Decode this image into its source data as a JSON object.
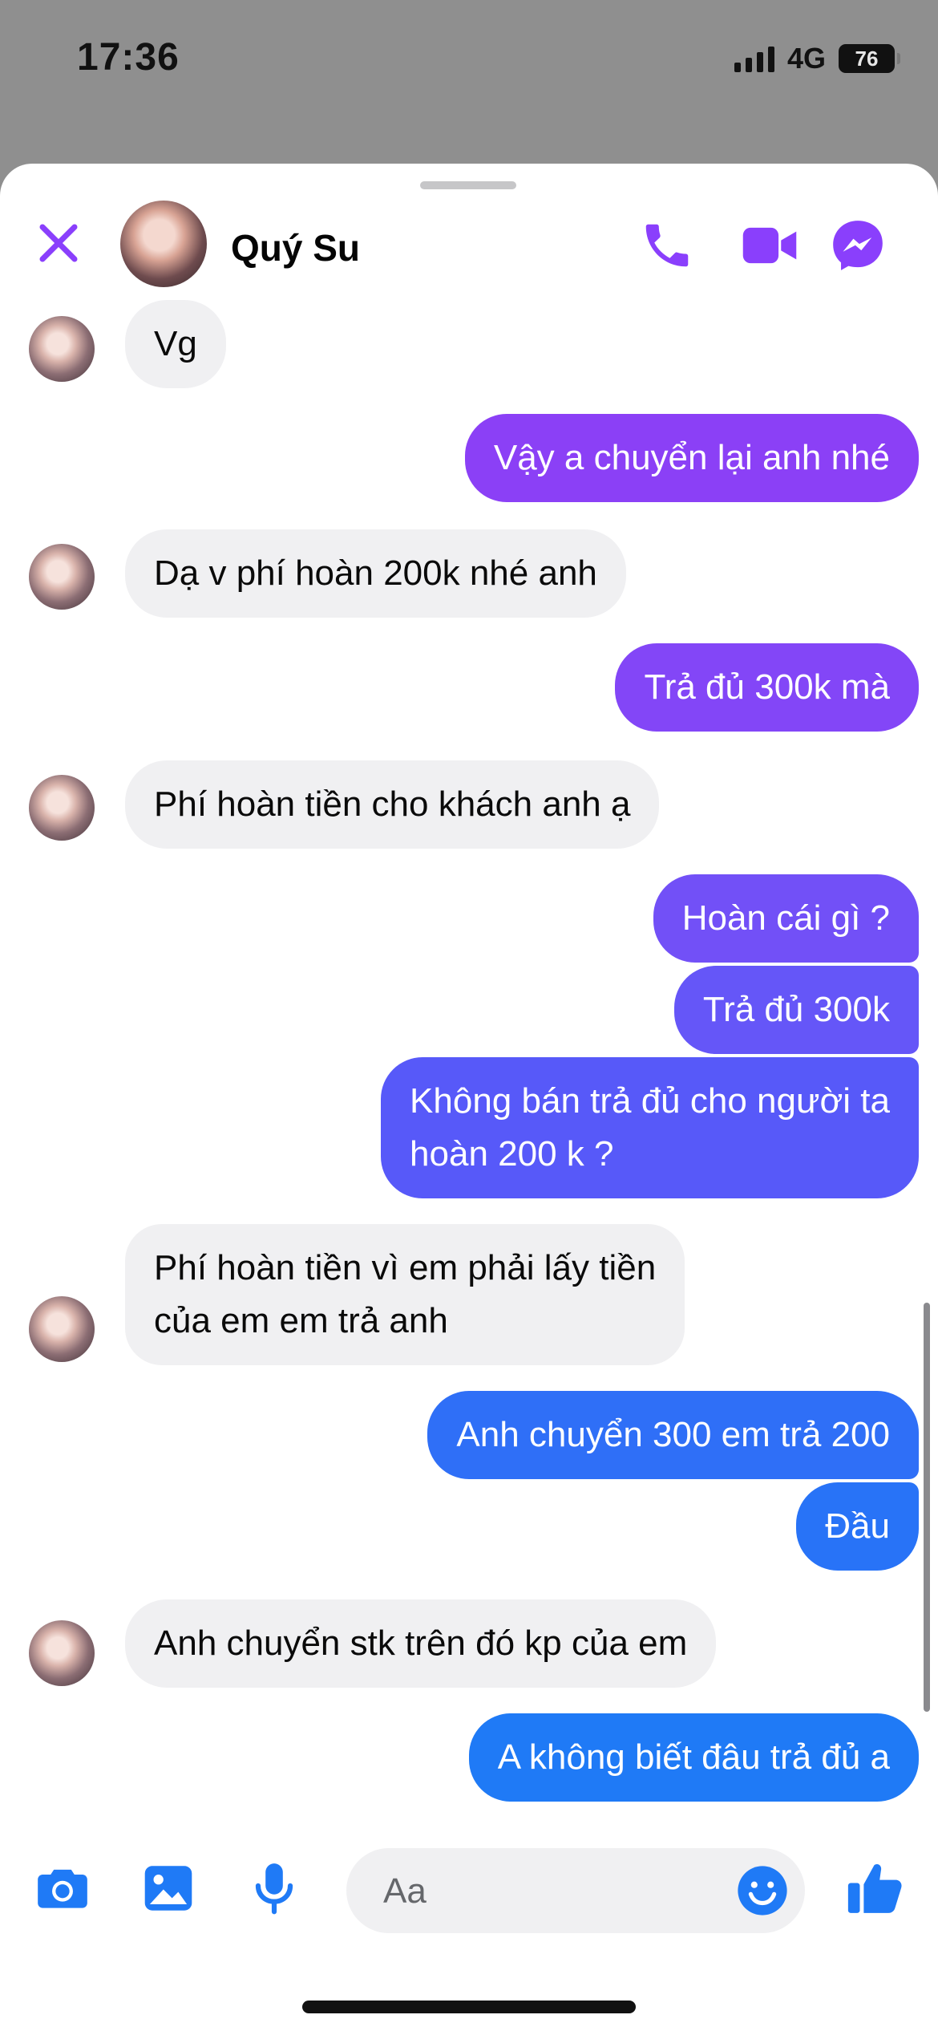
{
  "status_bar": {
    "time": "17:36",
    "network": "4G",
    "battery": "76"
  },
  "header": {
    "contact_name": "Quý Su"
  },
  "colors": {
    "accent": "#8a3ffc",
    "incoming_bubble": "#f0f0f2",
    "outgoing_gradient_top": "#8b40f6",
    "outgoing_gradient_bottom": "#1f7af6"
  },
  "messages": [
    {
      "side": "in",
      "text": "Vg"
    },
    {
      "side": "out",
      "text": "Vậy a chuyển lại anh nhé"
    },
    {
      "side": "in",
      "text": "Dạ v phí hoàn 200k nhé anh"
    },
    {
      "side": "out",
      "text": "Trả đủ 300k mà"
    },
    {
      "side": "in",
      "text": "Phí hoàn tiền cho khách anh ạ"
    },
    {
      "side": "out",
      "text": "Hoàn cái gì ?"
    },
    {
      "side": "out",
      "text": "Trả đủ 300k"
    },
    {
      "side": "out",
      "text": "Không bán trả đủ cho người ta\nhoàn 200 k ?"
    },
    {
      "side": "in",
      "text": "Phí hoàn tiền vì em phải lấy tiền\ncủa em em trả anh"
    },
    {
      "side": "out",
      "text": "Anh chuyển 300 em trả 200"
    },
    {
      "side": "out",
      "text": "Đầu"
    },
    {
      "side": "in",
      "text": "Anh chuyển stk trên đó kp của em"
    },
    {
      "side": "out",
      "text": "A không biết đâu trả đủ a"
    }
  ],
  "composer": {
    "placeholder": "Aa"
  }
}
